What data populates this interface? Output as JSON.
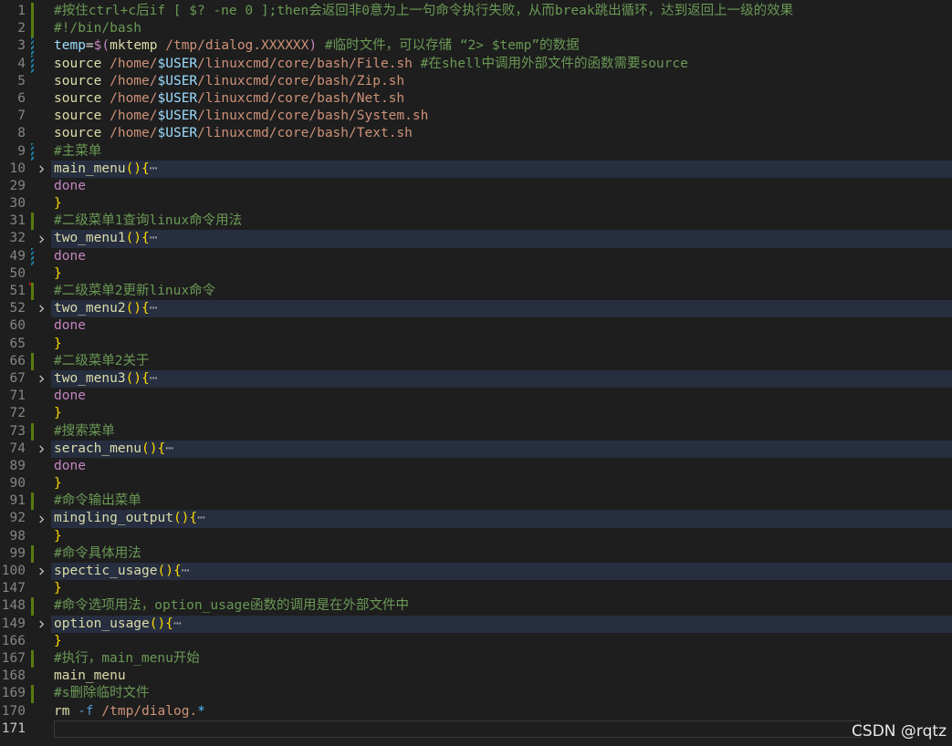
{
  "editor": {
    "lines": [
      {
        "num": "1",
        "mark": "added",
        "tokens": [
          [
            "c-comment",
            "#按住ctrl+c后if [ $? -ne 0 ];then会返回非0意为上一句命令执行失败，从而break跳出循环，达到返回上一级的效果"
          ]
        ]
      },
      {
        "num": "2",
        "mark": "added",
        "tokens": [
          [
            "c-comment",
            "#!/bin/bash"
          ]
        ]
      },
      {
        "num": "3",
        "mark": "modified",
        "tokens": [
          [
            "c-var",
            "temp"
          ],
          [
            "c-op",
            "="
          ],
          [
            "c-keyword",
            "$("
          ],
          [
            "c-func",
            "mktemp"
          ],
          [
            "c-string",
            " /tmp/dialog.XXXXXX"
          ],
          [
            "c-keyword",
            ")"
          ],
          [
            "c-comment",
            " #临时文件，可以存储 “2> $temp”的数据"
          ]
        ]
      },
      {
        "num": "4",
        "mark": "modified",
        "tokens": [
          [
            "c-func",
            "source"
          ],
          [
            "c-string",
            " /home/"
          ],
          [
            "c-var",
            "$USER"
          ],
          [
            "c-string",
            "/linuxcmd/core/bash/File.sh"
          ],
          [
            "c-comment",
            " #在shell中调用外部文件的函数需要source"
          ]
        ]
      },
      {
        "num": "5",
        "mark": "",
        "tokens": [
          [
            "c-func",
            "source"
          ],
          [
            "c-string",
            " /home/"
          ],
          [
            "c-var",
            "$USER"
          ],
          [
            "c-string",
            "/linuxcmd/core/bash/Zip.sh"
          ]
        ]
      },
      {
        "num": "6",
        "mark": "",
        "tokens": [
          [
            "c-func",
            "source"
          ],
          [
            "c-string",
            " /home/"
          ],
          [
            "c-var",
            "$USER"
          ],
          [
            "c-string",
            "/linuxcmd/core/bash/Net.sh"
          ]
        ]
      },
      {
        "num": "7",
        "mark": "",
        "tokens": [
          [
            "c-func",
            "source"
          ],
          [
            "c-string",
            " /home/"
          ],
          [
            "c-var",
            "$USER"
          ],
          [
            "c-string",
            "/linuxcmd/core/bash/System.sh"
          ]
        ]
      },
      {
        "num": "8",
        "mark": "",
        "tokens": [
          [
            "c-func",
            "source"
          ],
          [
            "c-string",
            " /home/"
          ],
          [
            "c-var",
            "$USER"
          ],
          [
            "c-string",
            "/linuxcmd/core/bash/Text.sh"
          ]
        ]
      },
      {
        "num": "9",
        "mark": "modified",
        "tokens": [
          [
            "c-comment",
            "#主菜单"
          ]
        ]
      },
      {
        "num": "10",
        "mark": "",
        "fold": true,
        "tokens": [
          [
            "c-func",
            "main_menu"
          ],
          [
            "c-brace",
            "(){"
          ],
          [
            "ellipsis",
            "⋯"
          ]
        ]
      },
      {
        "num": "29",
        "mark": "",
        "tokens": [
          [
            "c-keyword",
            "done"
          ]
        ]
      },
      {
        "num": "30",
        "mark": "",
        "tokens": [
          [
            "c-brace",
            "}"
          ]
        ]
      },
      {
        "num": "31",
        "mark": "added",
        "tokens": [
          [
            "c-comment",
            "#二级菜单1查询linux命令用法"
          ]
        ]
      },
      {
        "num": "32",
        "mark": "",
        "fold": true,
        "tokens": [
          [
            "c-func",
            "two_menu1"
          ],
          [
            "c-brace",
            "(){"
          ],
          [
            "ellipsis",
            "⋯"
          ]
        ]
      },
      {
        "num": "49",
        "mark": "modified",
        "tokens": [
          [
            "c-keyword",
            "done"
          ]
        ]
      },
      {
        "num": "50",
        "mark": "deleted",
        "tokens": [
          [
            "c-brace",
            "}"
          ]
        ]
      },
      {
        "num": "51",
        "mark": "added",
        "tokens": [
          [
            "c-comment",
            "#二级菜单2更新linux命令"
          ]
        ]
      },
      {
        "num": "52",
        "mark": "",
        "fold": true,
        "tokens": [
          [
            "c-func",
            "two_menu2"
          ],
          [
            "c-brace",
            "(){"
          ],
          [
            "ellipsis",
            "⋯"
          ]
        ]
      },
      {
        "num": "60",
        "mark": "",
        "tokens": [
          [
            "c-keyword",
            "done"
          ]
        ]
      },
      {
        "num": "65",
        "mark": "",
        "tokens": [
          [
            "c-brace",
            "}"
          ]
        ]
      },
      {
        "num": "66",
        "mark": "added",
        "tokens": [
          [
            "c-comment",
            "#二级菜单2关于"
          ]
        ]
      },
      {
        "num": "67",
        "mark": "",
        "fold": true,
        "tokens": [
          [
            "c-func",
            "two_menu3"
          ],
          [
            "c-brace",
            "(){"
          ],
          [
            "ellipsis",
            "⋯"
          ]
        ]
      },
      {
        "num": "71",
        "mark": "",
        "tokens": [
          [
            "c-keyword",
            "done"
          ]
        ]
      },
      {
        "num": "72",
        "mark": "",
        "tokens": [
          [
            "c-brace",
            "}"
          ]
        ]
      },
      {
        "num": "73",
        "mark": "added",
        "tokens": [
          [
            "c-comment",
            "#搜索菜单"
          ]
        ]
      },
      {
        "num": "74",
        "mark": "",
        "fold": true,
        "tokens": [
          [
            "c-func",
            "serach_menu"
          ],
          [
            "c-brace",
            "(){"
          ],
          [
            "ellipsis",
            "⋯"
          ]
        ]
      },
      {
        "num": "89",
        "mark": "",
        "tokens": [
          [
            "c-keyword",
            "done"
          ]
        ]
      },
      {
        "num": "90",
        "mark": "",
        "tokens": [
          [
            "c-brace",
            "}"
          ]
        ]
      },
      {
        "num": "91",
        "mark": "added",
        "tokens": [
          [
            "c-comment",
            "#命令输出菜单"
          ]
        ]
      },
      {
        "num": "92",
        "mark": "",
        "fold": true,
        "tokens": [
          [
            "c-func",
            "mingling_output"
          ],
          [
            "c-brace",
            "(){"
          ],
          [
            "ellipsis",
            "⋯"
          ]
        ]
      },
      {
        "num": "98",
        "mark": "",
        "tokens": [
          [
            "c-brace",
            "}"
          ]
        ]
      },
      {
        "num": "99",
        "mark": "added",
        "tokens": [
          [
            "c-comment",
            "#命令具体用法"
          ]
        ]
      },
      {
        "num": "100",
        "mark": "",
        "fold": true,
        "tokens": [
          [
            "c-func",
            "spectic_usage"
          ],
          [
            "c-brace",
            "(){"
          ],
          [
            "ellipsis",
            "⋯"
          ]
        ]
      },
      {
        "num": "147",
        "mark": "",
        "tokens": [
          [
            "c-brace",
            "}"
          ]
        ]
      },
      {
        "num": "148",
        "mark": "added",
        "tokens": [
          [
            "c-comment",
            "#命令选项用法，option_usage函数的调用是在外部文件中"
          ]
        ]
      },
      {
        "num": "149",
        "mark": "",
        "fold": true,
        "tokens": [
          [
            "c-func",
            "option_usage"
          ],
          [
            "c-brace",
            "(){"
          ],
          [
            "ellipsis",
            "⋯"
          ]
        ]
      },
      {
        "num": "166",
        "mark": "",
        "tokens": [
          [
            "c-brace",
            "}"
          ]
        ]
      },
      {
        "num": "167",
        "mark": "added",
        "tokens": [
          [
            "c-comment",
            "#执行，main_menu开始"
          ]
        ]
      },
      {
        "num": "168",
        "mark": "",
        "tokens": [
          [
            "c-func",
            "main_menu"
          ]
        ]
      },
      {
        "num": "169",
        "mark": "added",
        "tokens": [
          [
            "c-comment",
            "#s删除临时文件"
          ]
        ]
      },
      {
        "num": "170",
        "mark": "",
        "tokens": [
          [
            "c-func",
            "rm"
          ],
          [
            "c-dollar",
            " -f"
          ],
          [
            "c-string",
            " /tmp/dialog."
          ],
          [
            "c-regex",
            "*"
          ]
        ]
      },
      {
        "num": "171",
        "mark": "",
        "cursor": true,
        "tokens": []
      }
    ]
  },
  "watermark": "CSDN @rqtz",
  "colors": {
    "background": "#1e1e1e",
    "comment": "#6a9955",
    "string": "#ce9178",
    "function": "#dcdcaa",
    "variable": "#9cdcfe",
    "keyword": "#c586c0",
    "brace": "#ffd700",
    "gutter_added": "#587c0c",
    "gutter_modified": "#1b81a8",
    "folded_line_bg": "#262e3f"
  }
}
